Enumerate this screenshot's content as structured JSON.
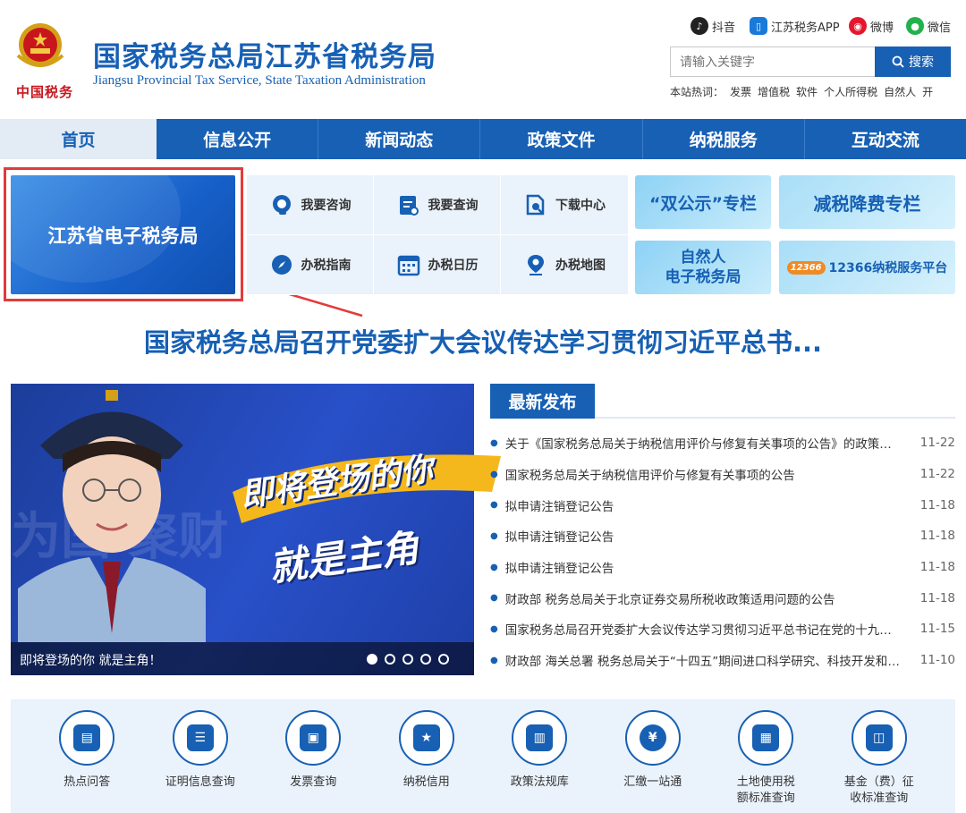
{
  "header": {
    "seal_text": "中国税务",
    "title": "国家税务总局江苏省税务局",
    "subtitle": "Jiangsu Provincial Tax Service, State Taxation Administration"
  },
  "social": {
    "douyin": "抖音",
    "app": "江苏税务APP",
    "weibo": "微博",
    "wechat": "微信"
  },
  "search": {
    "placeholder": "请输入关键字",
    "button": "搜索",
    "hot_label": "本站热词：",
    "hot_words": [
      "发票",
      "增值税",
      "软件",
      "个人所得税",
      "自然人",
      "开"
    ]
  },
  "nav": [
    "首页",
    "信息公开",
    "新闻动态",
    "政策文件",
    "纳税服务",
    "互动交流"
  ],
  "etax": {
    "label": "江苏省电子税务局"
  },
  "quick_links": [
    {
      "label": "我要咨询",
      "icon": "headset-icon"
    },
    {
      "label": "我要查询",
      "icon": "clipboard-search-icon"
    },
    {
      "label": "下载中心",
      "icon": "download-doc-icon"
    },
    {
      "label": "办税指南",
      "icon": "compass-icon"
    },
    {
      "label": "办税日历",
      "icon": "calendar-icon"
    },
    {
      "label": "办税地图",
      "icon": "map-pin-icon"
    }
  ],
  "promos": {
    "p1": "“双公示”专栏",
    "p2": "减税降费专栏",
    "p3_line1": "自然人",
    "p3_line2": "电子税务局",
    "p4": "12366纳税服务平台",
    "p4_badge": "12366"
  },
  "headline": "国家税务总局召开党委扩大会议传达学习贯彻习近平总书...",
  "banner": {
    "bg_text": "为国 聚财",
    "slogan_1": "即将登场的你",
    "slogan_2": "就是主角",
    "caption": "即将登场的你 就是主角！",
    "slides": 5,
    "active_slide": 1
  },
  "news": {
    "tab": "最新发布",
    "items": [
      {
        "title": "关于《国家税务总局关于纳税信用评价与修复有关事项的公告》的政策解读",
        "date": "11-22"
      },
      {
        "title": "国家税务总局关于纳税信用评价与修复有关事项的公告",
        "date": "11-22"
      },
      {
        "title": "拟申请注销登记公告",
        "date": "11-18"
      },
      {
        "title": "拟申请注销登记公告",
        "date": "11-18"
      },
      {
        "title": "拟申请注销登记公告",
        "date": "11-18"
      },
      {
        "title": "财政部 税务总局关于北京证券交易所税收政策适用问题的公告",
        "date": "11-18"
      },
      {
        "title": "国家税务总局召开党委扩大会议传达学习贯彻习近平总书记在党的十九届六中全会",
        "date": "11-15"
      },
      {
        "title": "财政部 海关总署 税务总局关于“十四五”期间进口科学研究、科技开发和教学用品",
        "date": "11-10"
      }
    ]
  },
  "services": [
    {
      "label": "热点问答",
      "icon": "chat-bubble-icon"
    },
    {
      "label": "证明信息查询",
      "icon": "certificate-icon"
    },
    {
      "label": "发票查询",
      "icon": "invoice-icon"
    },
    {
      "label": "纳税信用",
      "icon": "award-icon"
    },
    {
      "label": "政策法规库",
      "icon": "book-icon"
    },
    {
      "label": "汇缴一站通",
      "icon": "tax-payment-icon"
    },
    {
      "label": "土地使用税额标准查询",
      "label_1": "土地使用税",
      "label_2": "额标准查询",
      "icon": "land-tax-icon"
    },
    {
      "label": "基金（费）征收标准查询",
      "label_1": "基金（费）征",
      "label_2": "收标准查询",
      "icon": "fund-icon"
    }
  ],
  "colors": {
    "primary": "#1760b4",
    "highlight": "#e33a3a",
    "light_bg": "#eaf2fb"
  }
}
